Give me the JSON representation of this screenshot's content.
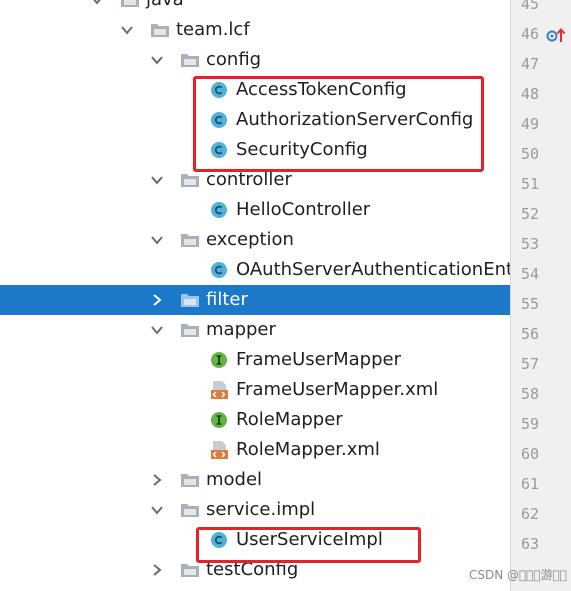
{
  "project_tree": {
    "items": [
      {
        "label": "java",
        "kind": "folder",
        "expanded": true
      },
      {
        "label": "team.lcf",
        "kind": "folder",
        "expanded": true
      },
      {
        "label": "config",
        "kind": "folder",
        "expanded": true
      },
      {
        "label": "AccessTokenConfig",
        "kind": "class"
      },
      {
        "label": "AuthorizationServerConfig",
        "kind": "class"
      },
      {
        "label": "SecurityConfig",
        "kind": "class"
      },
      {
        "label": "controller",
        "kind": "folder",
        "expanded": true
      },
      {
        "label": "HelloController",
        "kind": "class"
      },
      {
        "label": "exception",
        "kind": "folder",
        "expanded": true
      },
      {
        "label": "OAuthServerAuthenticationEntr",
        "kind": "class"
      },
      {
        "label": "filter",
        "kind": "folder",
        "expanded": false,
        "selected": true
      },
      {
        "label": "mapper",
        "kind": "folder",
        "expanded": true
      },
      {
        "label": "FrameUserMapper",
        "kind": "interface"
      },
      {
        "label": "FrameUserMapper.xml",
        "kind": "xml"
      },
      {
        "label": "RoleMapper",
        "kind": "interface"
      },
      {
        "label": "RoleMapper.xml",
        "kind": "xml"
      },
      {
        "label": "model",
        "kind": "folder",
        "expanded": false
      },
      {
        "label": "service.impl",
        "kind": "folder",
        "expanded": true
      },
      {
        "label": "UserServiceImpl",
        "kind": "class"
      },
      {
        "label": "testConfig",
        "kind": "folder",
        "expanded": false
      }
    ]
  },
  "gutter": {
    "line_numbers": [
      "45",
      "46",
      "47",
      "48",
      "49",
      "50",
      "51",
      "52",
      "53",
      "54",
      "55",
      "56",
      "57",
      "58",
      "59",
      "60",
      "61",
      "62",
      "63"
    ],
    "marker_icon": "override-up-arrow-icon"
  },
  "colors": {
    "selection": "#1c78c8",
    "class_icon": "#4fb0d8",
    "interface_icon": "#62b543",
    "annotation_box": "#e8202a"
  },
  "watermark": "CSDN @\u0000\u0000\u0000游\u0000\u0000"
}
